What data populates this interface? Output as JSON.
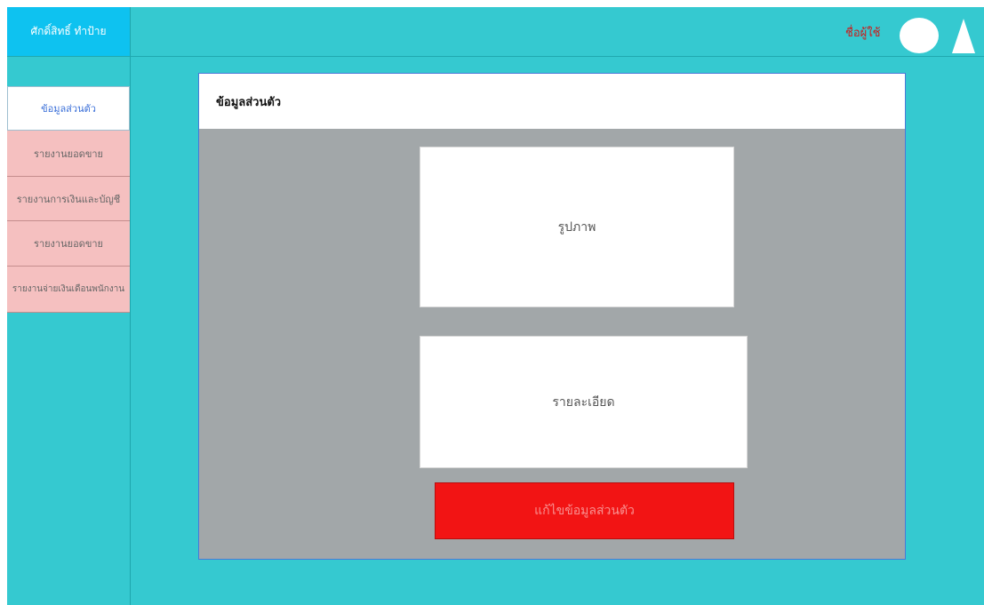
{
  "header": {
    "brand": "ศักดิ์สิทธิ์ ทำป้าย",
    "user_name": "ชื่อผู้ใช้",
    "avatar_icon": "user-avatar-icon",
    "menu_icon": "triangle-menu-icon"
  },
  "sidebar": {
    "items": [
      {
        "label": "ข้อมูลส่วนตัว",
        "active": true
      },
      {
        "label": "รายงานยอดขาย",
        "active": false
      },
      {
        "label": "รายงานการเงินและบัญชี",
        "active": false
      },
      {
        "label": "รายงานยอดขาย",
        "active": false
      },
      {
        "label": "รายงานจ่ายเงินเดือนพนักงาน",
        "active": false
      }
    ]
  },
  "main": {
    "title": "ข้อมูลส่วนตัว",
    "photo_label": "รูปภาพ",
    "details_label": "รายละเอียด",
    "edit_button": "แก้ไขข้อมูลส่วนตัว"
  },
  "colors": {
    "background": "#35c9d0",
    "brand": "#0ec2f0",
    "active_item_text": "#3a6fd8",
    "menu_item": "#f5c0c0",
    "panel": "#a2a7a9",
    "edit_button": "#f21414",
    "user_name": "#cc1a1a"
  }
}
